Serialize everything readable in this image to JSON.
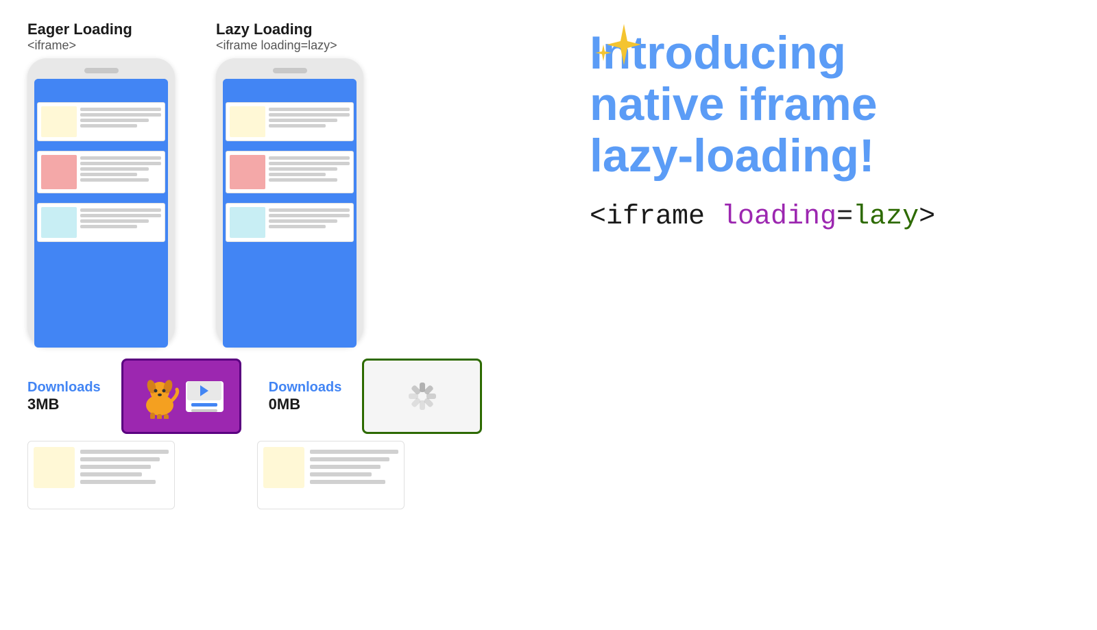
{
  "eager": {
    "title": "Eager Loading",
    "subtitle": "<iframe>",
    "downloads_label": "Downloads",
    "downloads_size": "3MB"
  },
  "lazy": {
    "title": "Lazy Loading",
    "subtitle": "<iframe loading=lazy>",
    "downloads_label": "Downloads",
    "downloads_size": "0MB"
  },
  "headline": {
    "line1": "Introducing",
    "line2": "native iframe",
    "line3": "lazy-loading!"
  },
  "code": {
    "part1": "<iframe ",
    "part2": "loading",
    "part3": "=",
    "part4": "lazy",
    "part5": ">"
  }
}
